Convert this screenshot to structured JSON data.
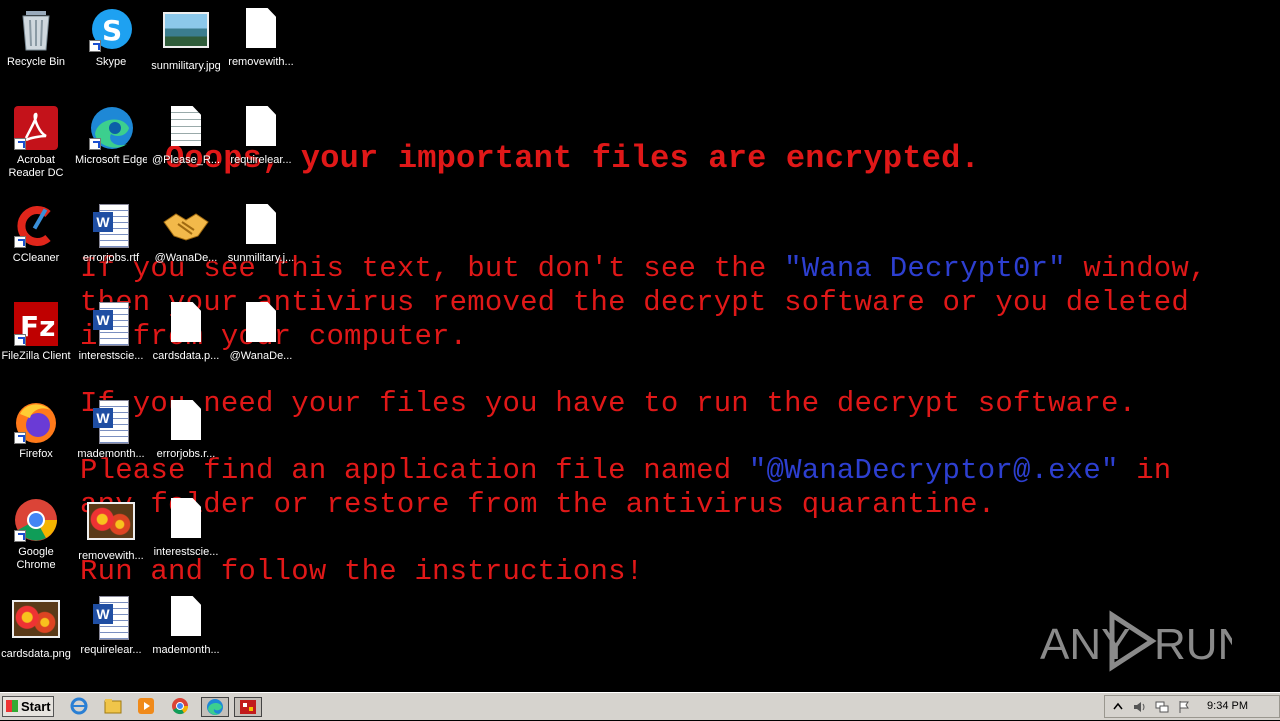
{
  "desktop_icons": [
    {
      "label": "Recycle Bin"
    },
    {
      "label": "Skype"
    },
    {
      "label": "sunmilitary.jpg"
    },
    {
      "label": "removewith..."
    },
    {
      "label": "Acrobat Reader DC"
    },
    {
      "label": "Microsoft Edge"
    },
    {
      "label": "@Please_R..."
    },
    {
      "label": "requirelear..."
    },
    {
      "label": "CCleaner"
    },
    {
      "label": "errorjobs.rtf"
    },
    {
      "label": "@WanaDe..."
    },
    {
      "label": "sunmilitary.j..."
    },
    {
      "label": "FileZilla Client"
    },
    {
      "label": "interestscie..."
    },
    {
      "label": "cardsdata.p..."
    },
    {
      "label": "@WanaDe..."
    },
    {
      "label": "Firefox"
    },
    {
      "label": "mademonth..."
    },
    {
      "label": "errorjobs.r..."
    },
    {
      "label": "Google Chrome"
    },
    {
      "label": "removewith..."
    },
    {
      "label": "interestscie..."
    },
    {
      "label": "cardsdata.png"
    },
    {
      "label": "requirelear..."
    },
    {
      "label": "mademonth..."
    }
  ],
  "ransom_note": {
    "title": "Ooops, your important files are encrypted.",
    "p1_a": "If you see this text, but don't see the ",
    "p1_blue": "\"Wana Decrypt0r\"",
    "p1_b": " window,",
    "p1_line2": "then your antivirus removed the decrypt software or you deleted",
    "p1_line3": "it from your computer.",
    "p2": "If you need your files you have to run the decrypt software.",
    "p3_a": "Please find an application file named ",
    "p3_blue": "\"@WanaDecryptor@.exe\"",
    "p3_b": " in",
    "p3_line2": "any folder or restore from the antivirus quarantine.",
    "p4": "Run and follow the instructions!"
  },
  "watermark": {
    "left": "ANY",
    "right": "RUN"
  },
  "taskbar": {
    "start_label": "Start",
    "clock": "9:34 PM"
  },
  "colors": {
    "note_red": "#e01818",
    "note_blue": "#2d3fd0",
    "taskbar": "#d6d3ce"
  }
}
